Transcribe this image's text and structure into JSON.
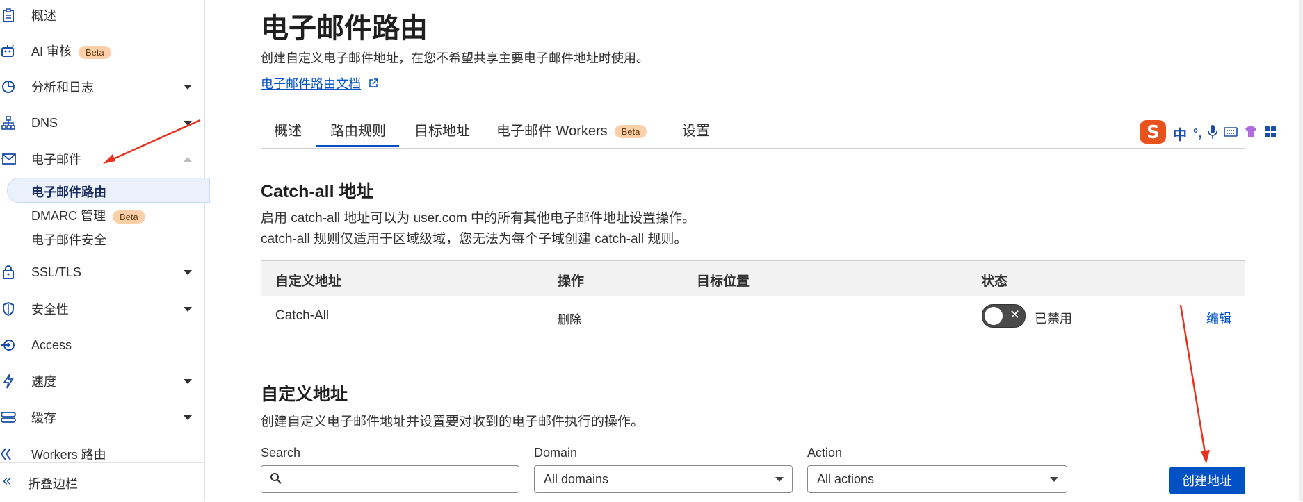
{
  "sidebar": {
    "items": [
      {
        "label": "概述",
        "icon": "clipboard-icon"
      },
      {
        "label": "AI 审核",
        "icon": "robot-icon",
        "badge": "Beta"
      },
      {
        "label": "分析和日志",
        "icon": "chart-pie-icon"
      },
      {
        "label": "DNS",
        "icon": "sitemap-icon"
      },
      {
        "label": "电子邮件",
        "icon": "mail-icon"
      },
      {
        "label": "SSL/TLS",
        "icon": "lock-icon"
      },
      {
        "label": "安全性",
        "icon": "shield-icon"
      },
      {
        "label": "Access",
        "icon": "access-icon"
      },
      {
        "label": "速度",
        "icon": "bolt-icon"
      },
      {
        "label": "缓存",
        "icon": "database-icon"
      },
      {
        "label": "Workers 路由",
        "icon": "workers-icon"
      }
    ],
    "email_sub": [
      {
        "label": "电子邮件路由"
      },
      {
        "label": "DMARC 管理",
        "badge": "Beta"
      },
      {
        "label": "电子邮件安全"
      }
    ],
    "collapse_label": "折叠边栏"
  },
  "header": {
    "title": "电子邮件路由",
    "description": "创建自定义电子邮件地址，在您不希望共享主要电子邮件地址时使用。",
    "docs_link": "电子邮件路由文档"
  },
  "tabs": [
    {
      "label": "概述"
    },
    {
      "label": "路由规则"
    },
    {
      "label": "目标地址"
    },
    {
      "label": "电子邮件 Workers",
      "badge": "Beta"
    },
    {
      "label": "设置"
    }
  ],
  "catchall": {
    "title": "Catch-all 地址",
    "desc_line1": "启用 catch-all 地址可以为 user.com 中的所有其他电子邮件地址设置操作。",
    "desc_line2": "catch-all 规则仅适用于区域级域，您无法为每个子域创建 catch-all 规则。",
    "columns": [
      "自定义地址",
      "操作",
      "目标位置",
      "状态"
    ],
    "row": {
      "address": "Catch-All",
      "action": "删除",
      "destination": "",
      "status": "已禁用",
      "edit": "编辑"
    }
  },
  "custom": {
    "title": "自定义地址",
    "desc": "创建自定义电子邮件地址并设置要对收到的电子邮件执行的操作。",
    "search_label": "Search",
    "search_value": "",
    "domain_label": "Domain",
    "domain_value": "All domains",
    "action_label": "Action",
    "action_value": "All actions",
    "create_button": "创建地址"
  },
  "ime": {
    "label": "中",
    "punct": "°,"
  },
  "colors": {
    "accent": "#0051c3",
    "badge": "#fbd0a8",
    "arrow": "#e8321e"
  }
}
